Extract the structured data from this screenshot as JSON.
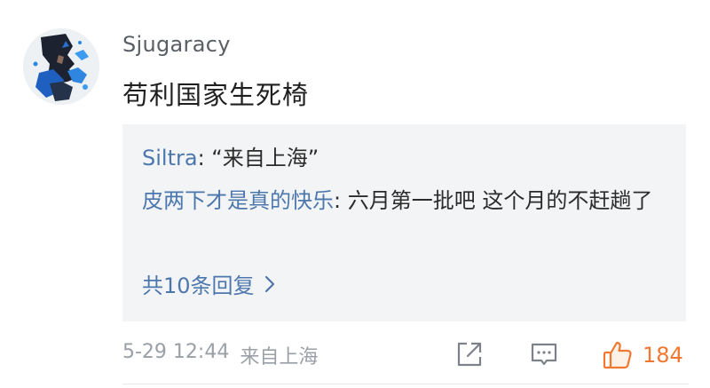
{
  "comment": {
    "username": "Sjugaracy",
    "text": "苟利国家生死椅",
    "avatar_icon": "avatar-person-blue-splash"
  },
  "replies": [
    {
      "author": "Siltra",
      "separator": ": ",
      "text": "“来自上海”"
    },
    {
      "author": "皮两下才是真的快乐",
      "separator": ": ",
      "text": "六月第一批吧 这个月的不赶趟了"
    }
  ],
  "more_replies": {
    "label": "共10条回复",
    "icon": "chevron-right-icon"
  },
  "meta": {
    "timestamp": "5-29 12:44",
    "location": "来自上海"
  },
  "actions": {
    "share_icon": "share-icon",
    "comment_icon": "comment-icon",
    "like_icon": "thumbs-up-icon",
    "like_count": "184"
  },
  "colors": {
    "link": "#4c77ac",
    "like_accent": "#f07830",
    "reply_background": "#f3f4f6",
    "muted_text": "#9aa0a6"
  }
}
